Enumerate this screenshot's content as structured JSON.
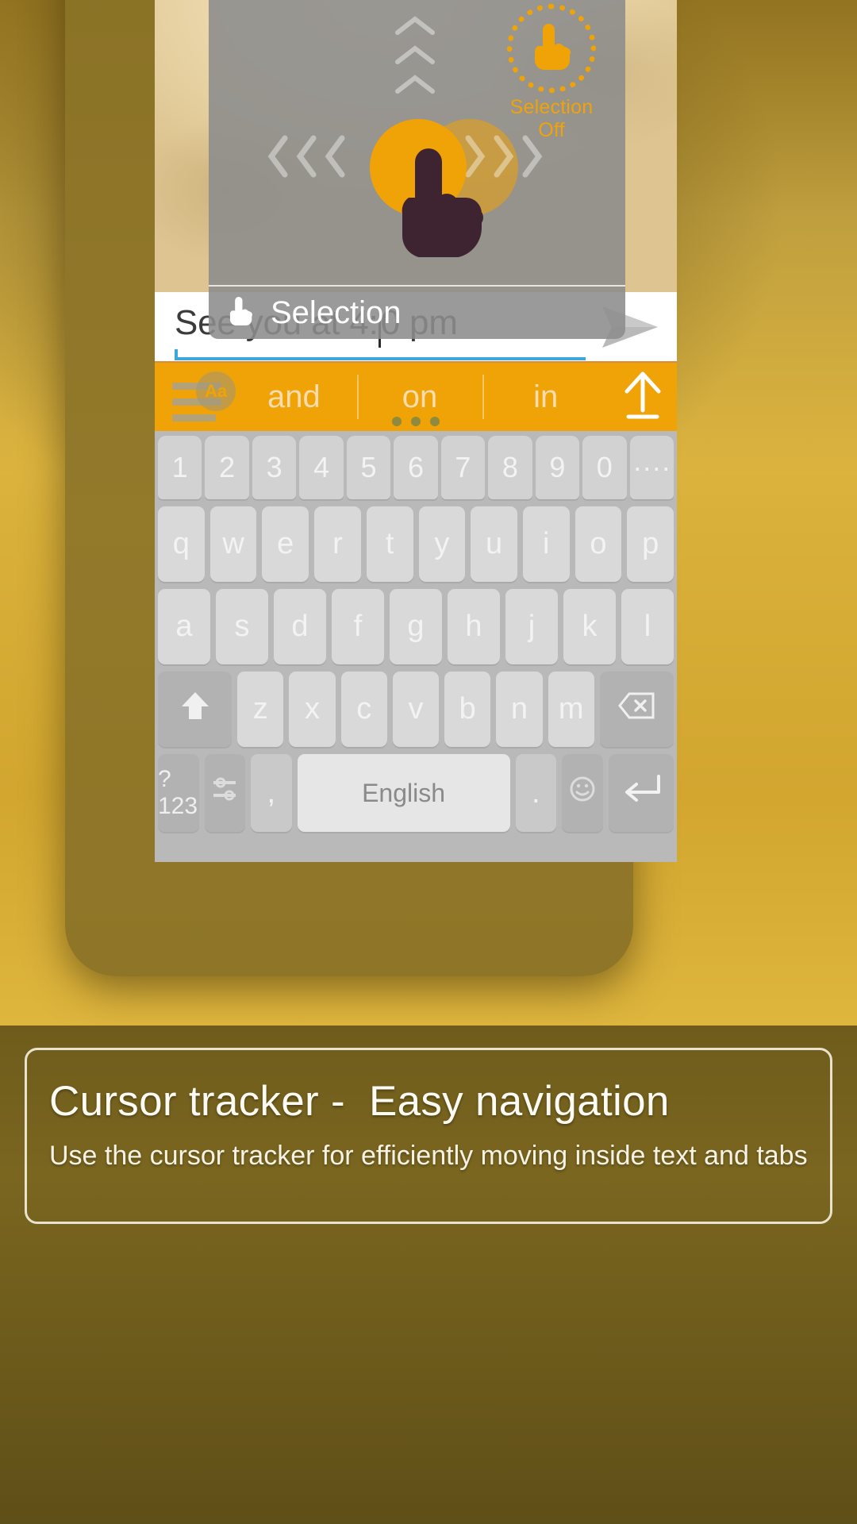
{
  "chat": {
    "input_value": "See you at 4:",
    "input_value_after_caret": "0 pm",
    "send_icon": "send-icon"
  },
  "suggestions": {
    "menu_icon": "hamburger-menu-icon",
    "aa_badge": "Aa",
    "items": [
      {
        "label": "and"
      },
      {
        "label": "on"
      },
      {
        "label": "in"
      }
    ],
    "expand_icon": "expand-up-icon"
  },
  "keyboard": {
    "number_row": [
      "1",
      "2",
      "3",
      "4",
      "5",
      "6",
      "7",
      "8",
      "9",
      "0"
    ],
    "row1": [
      "q",
      "w",
      "e",
      "r",
      "t",
      "y",
      "u",
      "i",
      "o",
      "p"
    ],
    "row2": [
      "a",
      "s",
      "d",
      "f",
      "g",
      "h",
      "j",
      "k",
      "l"
    ],
    "row3": [
      "z",
      "x",
      "c",
      "v",
      "b",
      "n",
      "m"
    ],
    "shift_key": "shift-icon",
    "backspace_key": "backspace-icon",
    "symbols_key": "?123",
    "settings_key": "settings-icon",
    "comma_key": ",",
    "space_key": "English",
    "period_key": ".",
    "emoji_key": "emoji-icon",
    "enter_key": "enter-icon",
    "more_key": "more-dots-icon"
  },
  "tracker": {
    "selection_state_label": "Selection Off",
    "selection_state_icon": "touch-pointer-icon",
    "footer_label": "Selection",
    "footer_icon": "touch-pointer-icon",
    "left_arrows_icon": "chevron-left-icon",
    "right_arrows_icon": "chevron-right-icon",
    "up_arrows_icon": "chevron-up-icon",
    "accent_color": "#efa307"
  },
  "caption": {
    "title": "Cursor tracker -  Easy navigation",
    "subtitle": "Use the cursor tracker for efficiently moving inside text and tabs"
  }
}
